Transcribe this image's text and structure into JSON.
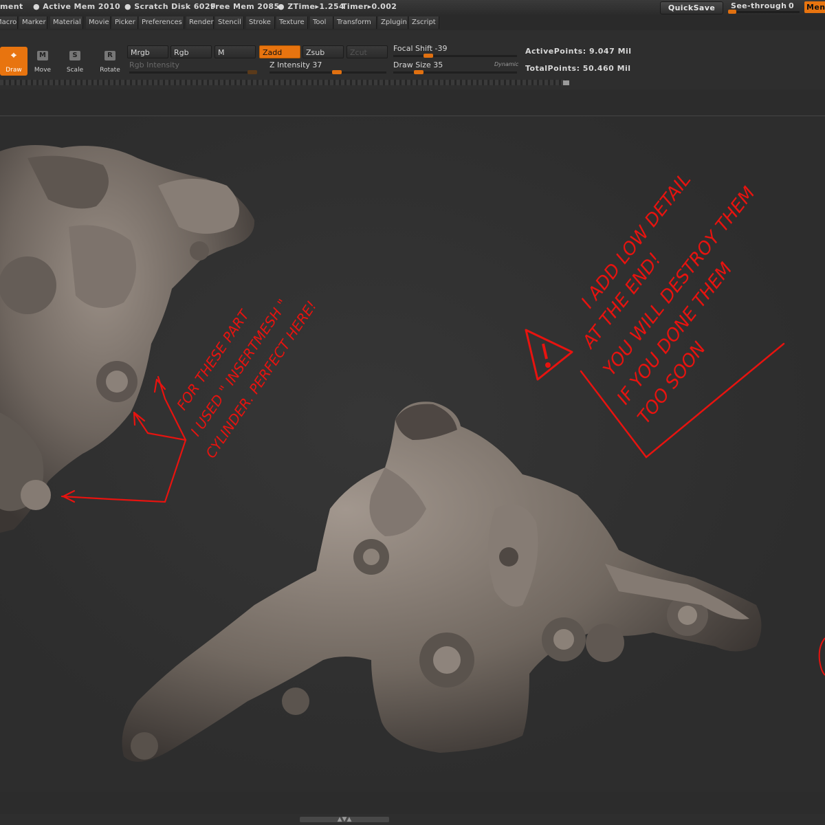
{
  "topbar": {
    "cut_label": "ment",
    "active_mem": "● Active Mem 2010",
    "scratch_disk": "● Scratch Disk 6029",
    "free_mem": "Free Mem 2085",
    "ztime": "● ZTime▸1.254",
    "timer": "Timer▸0.002",
    "quicksave_label": "QuickSave",
    "see_through_label": "See-through",
    "see_through_value": "0",
    "menus_label": "Menus"
  },
  "menubar": {
    "items": [
      "Macro",
      "Marker",
      "Material",
      "Movie",
      "Picker",
      "Preferences",
      "Render",
      "Stencil",
      "Stroke",
      "Texture",
      "Tool",
      "Transform",
      "Zplugin",
      "Zscript"
    ]
  },
  "toolbar": {
    "tools": [
      {
        "label": "Draw",
        "icon": "draw-crosshair-icon",
        "active": true
      },
      {
        "label": "Move",
        "icon": "move-icon",
        "letter": "M",
        "active": false
      },
      {
        "label": "Scale",
        "icon": "scale-icon",
        "letter": "S",
        "active": false
      },
      {
        "label": "Rotate",
        "icon": "rotate-icon",
        "letter": "R",
        "active": false
      }
    ],
    "mrgb": "Mrgb",
    "rgb": "Rgb",
    "m": "M",
    "zadd": "Zadd",
    "zsub": "Zsub",
    "zcut": "Zcut",
    "rgb_intensity": "Rgb Intensity",
    "z_intensity": "Z Intensity 37",
    "focal_shift": "Focal Shift -39",
    "draw_size": "Draw Size 35",
    "dynamic": "Dynamic",
    "active_points": "ActivePoints: 9.047 Mil",
    "total_points": "TotalPoints: 50.460 Mil"
  },
  "annotations": {
    "note_left_lines": [
      "FOR THESE PART",
      "I USED \" INSERTMESH \"",
      "CYLINDER. PERFECT HERE!"
    ],
    "note_right_lines": [
      "I ADD LOW DETAIL",
      "AT THE END!",
      "YOU WILL DESTROY THEM",
      "IF YOU DONE THEM",
      "TOO SOON"
    ],
    "annotation_color": "#e8130f"
  },
  "colors": {
    "accent": "#e8740f",
    "viewport_bg": "#2f2f2f",
    "clay": "#7a7068"
  }
}
